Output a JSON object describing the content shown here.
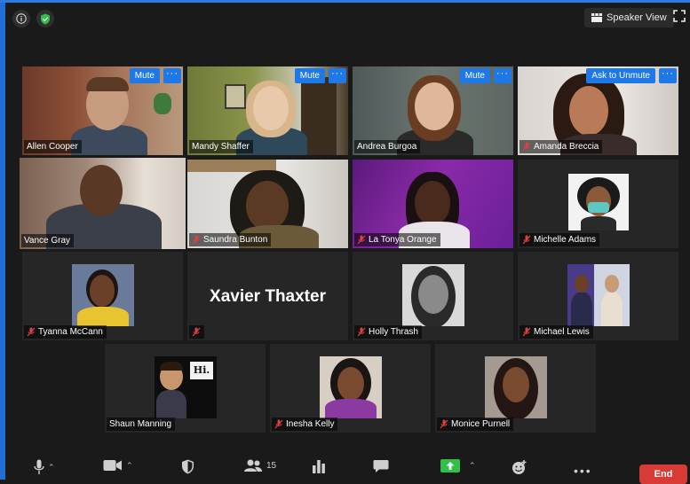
{
  "window": {
    "speaker_view_label": "Speaker View"
  },
  "participants": [
    {
      "name": "Allen Cooper",
      "mute_label": "Mute",
      "more": "···"
    },
    {
      "name": "Mandy Shaffer",
      "mute_label": "Mute",
      "more": "···"
    },
    {
      "name": "Andrea Burgoa",
      "mute_label": "Mute",
      "more": "···"
    },
    {
      "name": "Amanda Breccia",
      "mute_label": "Ask to Unmute",
      "more": "···"
    },
    {
      "name": "Vance Gray"
    },
    {
      "name": "Saundra Bunton"
    },
    {
      "name": "La Tonya Orange"
    },
    {
      "name": "Michelle Adams"
    },
    {
      "name": "Tyanna McCann"
    },
    {
      "name": "Xavier Thaxter",
      "display_name": "Xavier Thaxter"
    },
    {
      "name": "Holly Thrash"
    },
    {
      "name": "Michael Lewis"
    },
    {
      "name": "Shaun Manning"
    },
    {
      "name": "Inesha Kelly"
    },
    {
      "name": "Monice Purnell"
    }
  ],
  "avatar_text": {
    "shaun_hi": "Hi."
  },
  "toolbar": {
    "participants_count": "15",
    "end_label": "End"
  },
  "colors": {
    "accent_blue": "#1e78e6",
    "active_speaker": "#c6e86a",
    "end_red": "#d83a36",
    "share_green": "#2fbf4a"
  }
}
